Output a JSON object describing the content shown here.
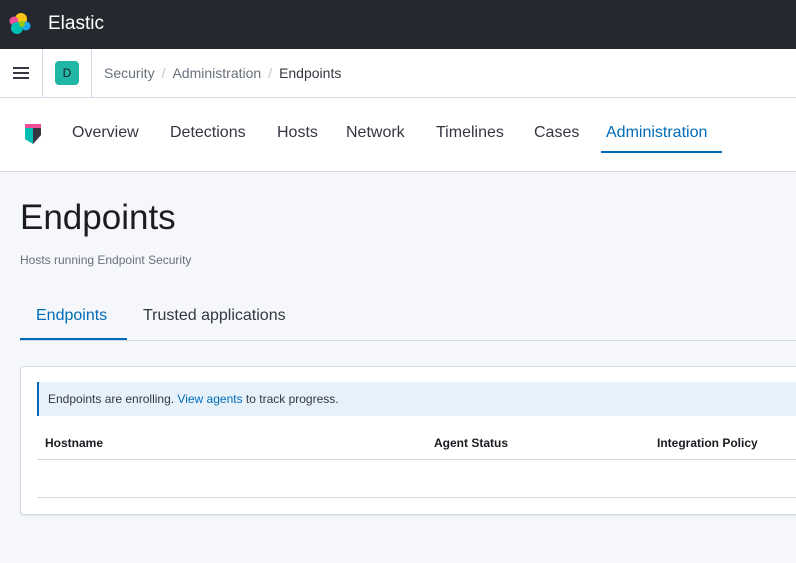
{
  "header": {
    "brand": "Elastic",
    "logo_icon": "elastic-logo-icon"
  },
  "breadcrumbs": {
    "menu_icon": "hamburger-menu-icon",
    "space_initial": "D",
    "items": [
      "Security",
      "Administration",
      "Endpoints"
    ],
    "separator": "/"
  },
  "app_nav": {
    "logo_icon": "security-app-logo-icon",
    "tabs": [
      "Overview",
      "Detections",
      "Hosts",
      "Network",
      "Timelines",
      "Cases",
      "Administration"
    ],
    "active_tab": "Administration"
  },
  "page": {
    "title": "Endpoints",
    "subtitle": "Hosts running Endpoint Security"
  },
  "tabs": {
    "items": [
      "Endpoints",
      "Trusted applications"
    ],
    "active": "Endpoints"
  },
  "callout": {
    "prefix": "Endpoints are enrolling. ",
    "link": "View agents",
    "suffix": " to track progress."
  },
  "table": {
    "columns": [
      "Hostname",
      "Agent Status",
      "Integration Policy"
    ],
    "rows": []
  },
  "colors": {
    "accent": "#006bb8",
    "header_bg": "#25282f",
    "space_avatar": "#20b7a6"
  }
}
